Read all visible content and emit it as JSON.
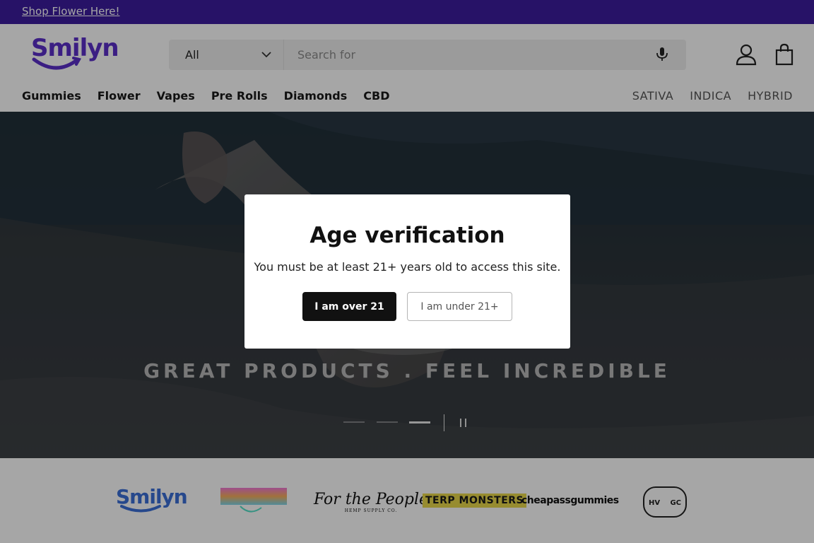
{
  "announcement": {
    "text": "Shop Flower Here!"
  },
  "header": {
    "logo_text": "Smilyn",
    "search": {
      "category": "All",
      "placeholder": "Search for"
    }
  },
  "nav": {
    "items": [
      "Gummies",
      "Flower",
      "Vapes",
      "Pre Rolls",
      "Diamonds",
      "CBD"
    ],
    "strains": [
      "SATIVA",
      "INDICA",
      "HYBRID"
    ]
  },
  "hero": {
    "tagline": "GREAT PRODUCTS . FEEL INCREDIBLE",
    "slides": 3,
    "active_slide": 3
  },
  "modal": {
    "title": "Age verification",
    "message": "You must be at least 21+ years old to access this site.",
    "confirm_label": "I am over 21",
    "deny_label": "I am under 21+"
  },
  "brands": {
    "smilyn": "Smilyn",
    "for_people": "For the People",
    "for_people_sub": "HEMP SUPPLY CO.",
    "terp": "TERP MONSTERS",
    "cheap": "cheapassgummies",
    "patriots_left": "HV",
    "patriots_right": "GC"
  },
  "colors": {
    "announcement_bg": "#3d1c9e",
    "brand_purple": "#5b2fc9",
    "search_bg": "#eeeeee",
    "confirm_button_bg": "#111111"
  }
}
